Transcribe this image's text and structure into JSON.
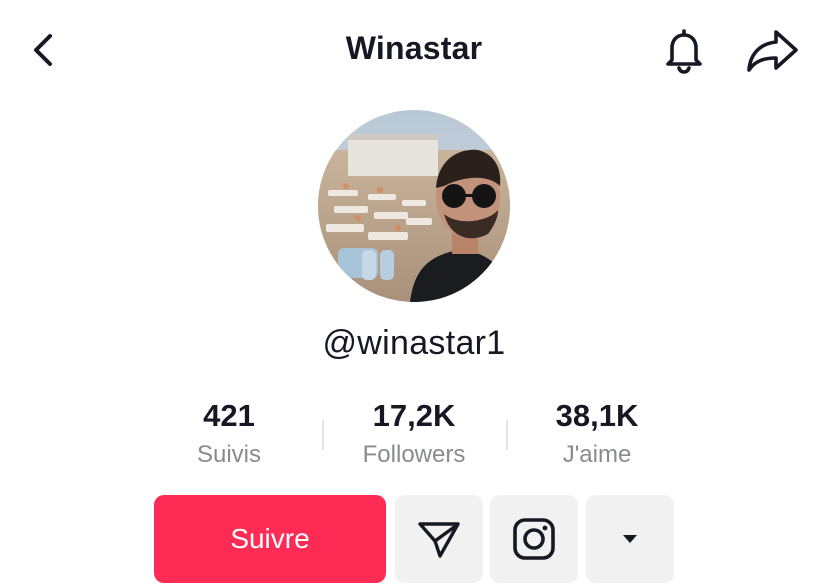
{
  "header": {
    "title": "Winastar",
    "back_icon": "chevron-left-icon",
    "bell_icon": "bell-icon",
    "share_icon": "share-arrow-icon"
  },
  "profile": {
    "handle": "@winastar1",
    "avatar_icon": "profile-photo"
  },
  "stats": [
    {
      "value": "421",
      "label": "Suivis"
    },
    {
      "value": "17,2K",
      "label": "Followers"
    },
    {
      "value": "38,1K",
      "label": "J'aime"
    }
  ],
  "actions": {
    "follow_label": "Suivre",
    "message_icon": "send-message-icon",
    "instagram_icon": "instagram-icon",
    "more_icon": "dropdown-triangle-icon"
  },
  "colors": {
    "accent": "#fe2c55",
    "secondary_button_bg": "#f1f1f2",
    "label_gray": "#8a8b91"
  }
}
